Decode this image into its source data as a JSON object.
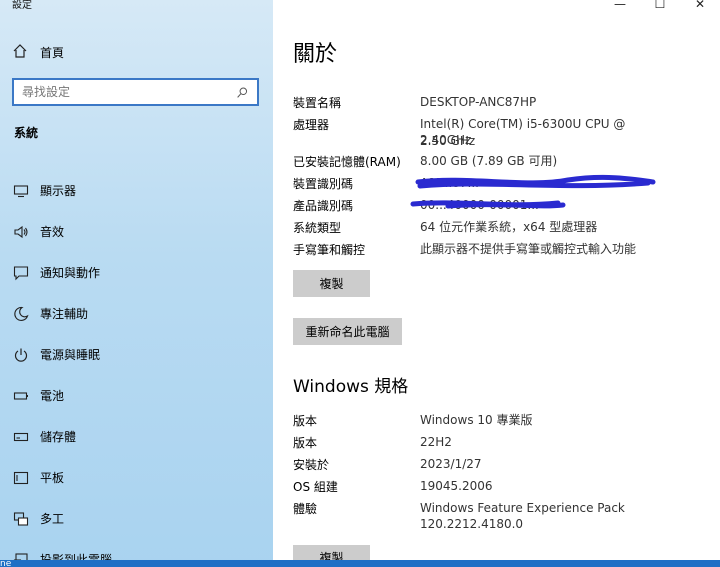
{
  "app": {
    "title": "設定"
  },
  "window_controls": {
    "minimize": "—",
    "maximize": "☐",
    "close": "✕"
  },
  "sidebar": {
    "home_label": "首頁",
    "search_placeholder": "尋找設定",
    "section": "系統",
    "items": [
      {
        "label": "顯示器",
        "icon": "monitor-icon"
      },
      {
        "label": "音效",
        "icon": "speaker-icon"
      },
      {
        "label": "通知與動作",
        "icon": "notification-icon"
      },
      {
        "label": "專注輔助",
        "icon": "moon-icon"
      },
      {
        "label": "電源與睡眠",
        "icon": "power-icon"
      },
      {
        "label": "電池",
        "icon": "battery-icon"
      },
      {
        "label": "儲存體",
        "icon": "storage-icon"
      },
      {
        "label": "平板",
        "icon": "tablet-icon"
      },
      {
        "label": "多工",
        "icon": "multitask-icon"
      },
      {
        "label": "投影到此電腦",
        "icon": "project-icon"
      }
    ]
  },
  "main": {
    "title": "關於",
    "device_specs": [
      {
        "key": "裝置名稱",
        "value": "DESKTOP-ANC87HP"
      },
      {
        "key": "處理器",
        "value": "Intel(R) Core(TM) i5-6300U CPU @ 2.40GHz",
        "value2": "2.50 GHz"
      },
      {
        "key": "已安裝記憶體(RAM)",
        "value": "8.00 GB (7.89 GB 可用)"
      },
      {
        "key": "裝置識別碼",
        "value": "A2F...87..."
      },
      {
        "key": "產品識別碼",
        "value": "00...40000-00001..."
      },
      {
        "key": "系統類型",
        "value": "64 位元作業系統，x64 型處理器"
      },
      {
        "key": "手寫筆和觸控",
        "value": "此顯示器不提供手寫筆或觸控式輸入功能"
      }
    ],
    "copy_button": "複製",
    "rename_button": "重新命名此電腦",
    "windows_title": "Windows 規格",
    "windows_specs": [
      {
        "key": "版本",
        "value": "Windows 10 專業版"
      },
      {
        "key": "版本",
        "value": "22H2"
      },
      {
        "key": "安裝於",
        "value": "2023/1/27"
      },
      {
        "key": "OS 組建",
        "value": "19045.2006"
      },
      {
        "key": "體驗",
        "value": "Windows Feature Experience Pack",
        "value2": "120.2212.4180.0"
      }
    ],
    "copy_button_2": "複製"
  },
  "taskbar": {
    "text": "ne"
  }
}
